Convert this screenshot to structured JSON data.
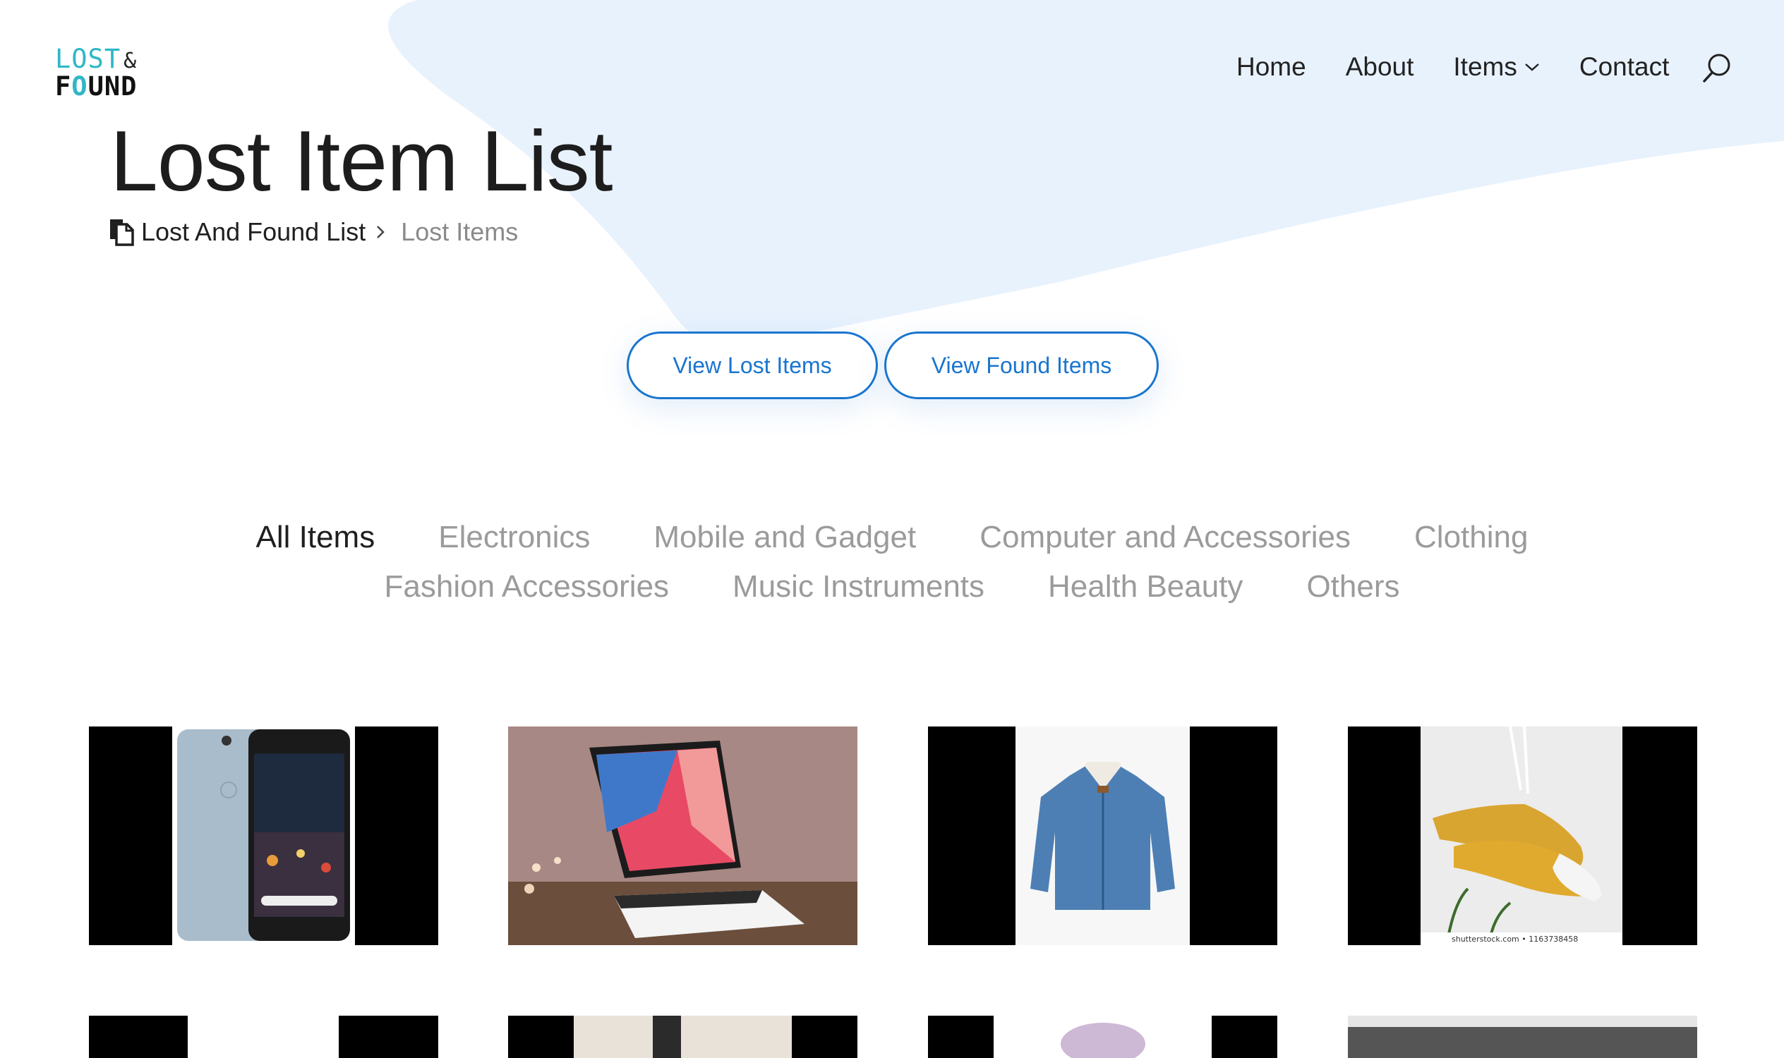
{
  "logo": {
    "line1": "LOST",
    "ampersand": "&",
    "line2_pre": "F",
    "line2_o": "O",
    "line2_post": "UND"
  },
  "nav": {
    "items": [
      {
        "label": "Home"
      },
      {
        "label": "About"
      },
      {
        "label": "Items",
        "icon": "chevron-down-icon"
      },
      {
        "label": "Contact"
      }
    ],
    "search_icon": "search-icon"
  },
  "page_title": "Lost Item List",
  "breadcrumb": {
    "icon": "document-icon",
    "link": "Lost And Found List",
    "separator_icon": "chevron-right-icon",
    "current": "Lost Items"
  },
  "buttons": {
    "view_lost": "View Lost Items",
    "view_found": "View Found Items"
  },
  "filters": {
    "row1": [
      "All Items",
      "Electronics",
      "Mobile and Gadget",
      "Computer and Accessories",
      "Clothing"
    ],
    "row2": [
      "Fashion Accessories",
      "Music Instruments",
      "Health Beauty",
      "Others"
    ],
    "active": "All Items"
  },
  "items": [
    {
      "image": "blue smartphone"
    },
    {
      "image": "tablet with keyboard"
    },
    {
      "image": "denim jacket"
    },
    {
      "image": "yellow sneakers",
      "watermark": "shutterstock.com • 1163738458"
    }
  ],
  "colors": {
    "accent": "#1a75cf",
    "background_shape": "#e8f2fd",
    "filter_inactive": "#9b9b9b",
    "logo_teal": "#2fb7c7"
  }
}
